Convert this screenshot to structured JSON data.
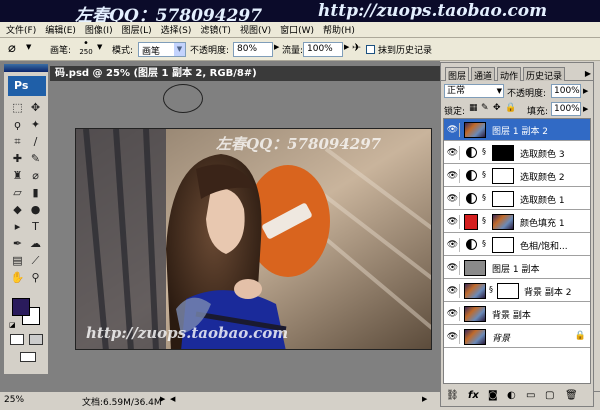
{
  "banner": {
    "left_text": "左春QQ：578094297",
    "right_text": "http://zuops.taobao.com"
  },
  "menu": [
    "文件(F)",
    "编辑(E)",
    "图像(I)",
    "图层(L)",
    "选择(S)",
    "滤镜(T)",
    "视图(V)",
    "窗口(W)",
    "帮助(H)"
  ],
  "options": {
    "brush_label": "画笔:",
    "brush_size": "250",
    "mode_label": "模式:",
    "mode_value": "画笔",
    "opacity_label": "不透明度:",
    "opacity_value": "80%",
    "flow_label": "流量:",
    "flow_value": "100%",
    "history_label": "抹到历史记录"
  },
  "document": {
    "title": "码.psd @ 25% (图层 1 副本 2, RGB/8#)",
    "watermark_top": "左春QQ：578094297",
    "watermark_bottom": "http://zuops.taobao.com"
  },
  "toolbox": {
    "logo": "Ps"
  },
  "status": {
    "zoom": "25%",
    "doc_info": "文档:6.59M/36.4M"
  },
  "layers_panel": {
    "tabs": [
      "图层",
      "通道",
      "动作",
      "历史记录"
    ],
    "blend_mode": "正常",
    "opacity_label": "不透明度:",
    "opacity_value": "100%",
    "lock_label": "锁定:",
    "fill_label": "填充:",
    "fill_value": "100%",
    "layers": [
      {
        "name": "图层 1 副本 2",
        "selected": true
      },
      {
        "name": "选取颜色 3"
      },
      {
        "name": "选取颜色 2"
      },
      {
        "name": "选取颜色 1"
      },
      {
        "name": "颜色填充 1"
      },
      {
        "name": "色相/饱和..."
      },
      {
        "name": "图层 1 副本"
      },
      {
        "name": "背景 副本 2"
      },
      {
        "name": "背景 副本"
      },
      {
        "name": "背景",
        "locked": true
      }
    ]
  },
  "colors": {
    "foreground": "#2a1b5c",
    "background": "#ffffff",
    "selection": "#316ac5",
    "sign_orange": "#d9641e",
    "fill_red": "#d41f1f"
  },
  "icons": {
    "eye": "eye-icon",
    "adjustment": "adjustment-layer-icon",
    "link": "chain-link-icon",
    "lock": "lock-icon"
  }
}
